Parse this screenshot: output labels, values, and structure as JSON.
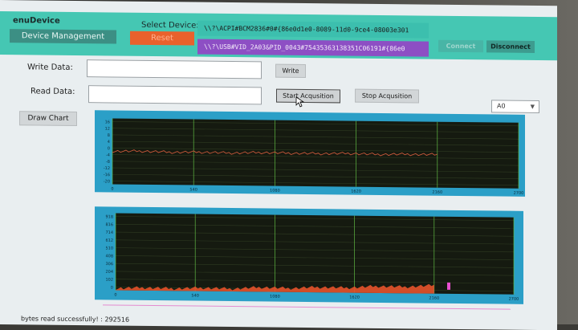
{
  "app": {
    "title": "enuDevice"
  },
  "header": {
    "device_management_label": "Device Management",
    "select_device_label": "Select Device:",
    "reset_label": "Reset",
    "devices": [
      "\\\\?\\ACPI#BCM2836#0#{86e0d1e0-8089-11d0-9ce4-08003e301",
      "\\\\?\\USB#VID_2A03&PID_0043#75435363138351C06191#{86e0"
    ],
    "connect_label": "Connect",
    "disconnect_label": "Disconnect"
  },
  "io": {
    "write_data_label": "Write Data:",
    "write_value": "",
    "write_button": "Write",
    "read_data_label": "Read Data:",
    "read_value": "",
    "start_button": "Start Acqusition",
    "stop_button": "Stop Acqusition",
    "channel_selected": "A0",
    "draw_chart_button": "Draw Chart"
  },
  "colors": {
    "accent": "#45c7b3",
    "selection": "#8d4fc4",
    "reset": "#e9612c",
    "chart_frame": "#2b9fc7"
  },
  "chart_data": [
    {
      "type": "line",
      "title": "",
      "x_ticks": [
        "0",
        "540",
        "1080",
        "1620",
        "2160",
        "2700"
      ],
      "y_ticks": [
        "16",
        "12",
        "8",
        "4",
        "0",
        "-4",
        "-8",
        "-12",
        "-16",
        "-20"
      ],
      "xlim": [
        0,
        2700
      ],
      "ylim": [
        -20,
        20
      ],
      "series": [
        {
          "values": [
            0,
            0.3,
            -0.2,
            0.1,
            -0.3,
            0.2,
            0,
            -0.1,
            0.2,
            -0.2,
            0.1,
            0
          ]
        }
      ],
      "grid": true
    },
    {
      "type": "area",
      "title": "",
      "x_ticks": [
        "0",
        "540",
        "1080",
        "1620",
        "2160",
        "2700"
      ],
      "y_ticks": [
        "918",
        "816",
        "714",
        "612",
        "510",
        "408",
        "306",
        "204",
        "102",
        "0"
      ],
      "xlim": [
        0,
        2700
      ],
      "ylim": [
        0,
        1020
      ],
      "series": [
        {
          "values": [
            25,
            40,
            30,
            45,
            35,
            60,
            50,
            70,
            65,
            90,
            85,
            110
          ]
        }
      ],
      "grid": true
    }
  ],
  "status": {
    "text": "bytes read successfully! : 292516"
  },
  "slider": {
    "value": 0.85
  }
}
